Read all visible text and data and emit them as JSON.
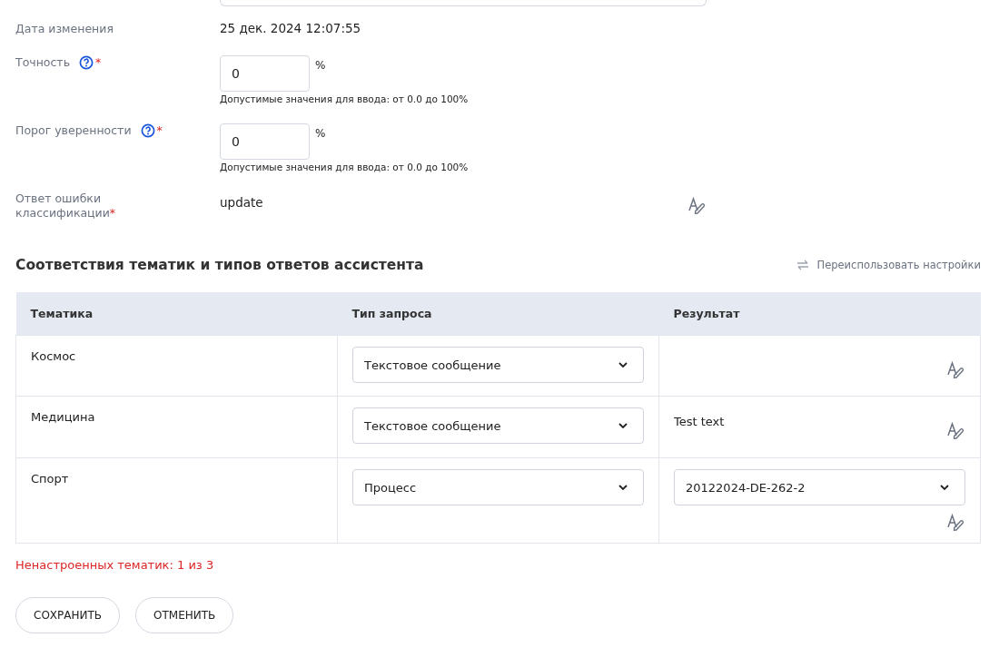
{
  "fields": [
    {
      "kind": "text",
      "label": "Дата изменения",
      "help": false,
      "value": "25 дек. 2024 12:07:55"
    },
    {
      "kind": "number",
      "label": "Точность",
      "required_mark": "*",
      "help": true,
      "value": "0",
      "unit": "%",
      "hint": "Допустимые значения для ввода: от 0.0 до 100%"
    },
    {
      "kind": "number",
      "label": "Порог уверенности",
      "required_mark": "*",
      "help": true,
      "value": "0",
      "unit": "%",
      "hint": "Допустимые значения для ввода: от 0.0 до 100%"
    },
    {
      "kind": "editable",
      "label": "Ответ ошибки классификации",
      "required_mark": "*",
      "help": false,
      "value": "update"
    }
  ],
  "section": {
    "title": "Соответствия тематик и типов ответов ассистента",
    "action": "Переиспользовать настройки"
  },
  "table": {
    "columns": [
      "Тематика",
      "Тип запроса",
      "Результат"
    ],
    "rows": [
      {
        "topic": "Космос",
        "request_type": "Текстовое сообщение",
        "result": {
          "kind": "empty"
        }
      },
      {
        "topic": "Медицина",
        "request_type": "Текстовое сообщение",
        "result": {
          "kind": "text",
          "value": "Test text"
        }
      },
      {
        "topic": "Спорт",
        "request_type": "Процесс",
        "result": {
          "kind": "select",
          "value": "20122024-DE-262-2"
        }
      }
    ]
  },
  "warning": "Ненастроенных тематик: 1 из 3",
  "buttons": [
    "СОХРАНИТЬ",
    "ОТМЕНИТЬ"
  ]
}
